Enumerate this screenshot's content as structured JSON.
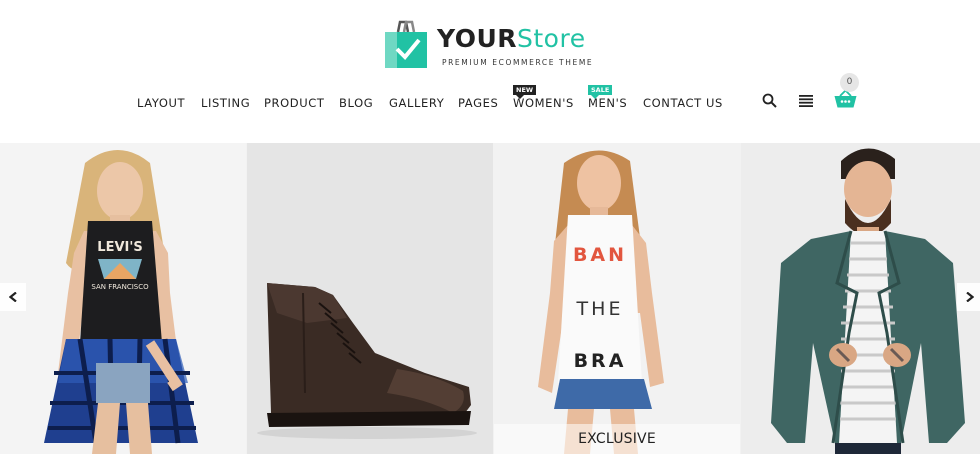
{
  "brand": {
    "name_part1": "YOUR",
    "name_part2": "Store",
    "tagline": "PREMIUM ECOMMERCE THEME",
    "accent_color": "#21c2a4"
  },
  "nav": {
    "items": [
      {
        "label": "LAYOUT"
      },
      {
        "label": "LISTING"
      },
      {
        "label": "PRODUCT"
      },
      {
        "label": "BLOG"
      },
      {
        "label": "GALLERY"
      },
      {
        "label": "PAGES"
      },
      {
        "label": "WOMEN'S",
        "badge": "NEW"
      },
      {
        "label": "MEN'S",
        "badge": "SALE"
      },
      {
        "label": "CONTACT US"
      }
    ]
  },
  "header_icons": {
    "search": "search-icon",
    "menu": "menu-icon",
    "cart": "cart-icon",
    "cart_count": "0"
  },
  "slider": {
    "slides": [
      {
        "subject": "woman-levis-tank",
        "print": [
          "LEVI'S",
          "SAN FRANCISCO"
        ]
      },
      {
        "subject": "leather-boot"
      },
      {
        "subject": "woman-ban-the-bra-tank",
        "print": [
          "BAN",
          "THE",
          "BRA"
        ],
        "caption": "EXCLUSIVE"
      },
      {
        "subject": "man-teal-blazer"
      }
    ],
    "prev_icon": "chevron-left-icon",
    "next_icon": "chevron-right-icon"
  }
}
